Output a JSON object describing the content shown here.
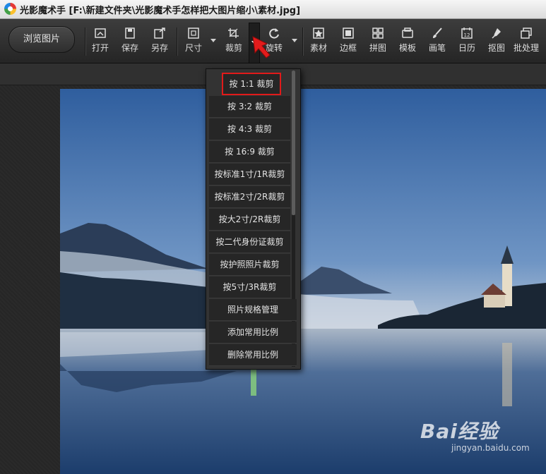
{
  "window": {
    "title": "光影魔术手 [F:\\新建文件夹\\光影魔术手怎样把大图片缩小\\素材.jpg]"
  },
  "toolbar": {
    "browse_label": "浏览图片",
    "tools": [
      {
        "label": "打开",
        "icon": "open-icon"
      },
      {
        "label": "保存",
        "icon": "save-icon"
      },
      {
        "label": "另存",
        "icon": "save-as-icon"
      },
      {
        "label": "尺寸",
        "icon": "resize-icon"
      },
      {
        "label": "裁剪",
        "icon": "crop-icon"
      },
      {
        "label": "旋转",
        "icon": "rotate-icon"
      },
      {
        "label": "素材",
        "icon": "material-icon"
      },
      {
        "label": "边框",
        "icon": "frame-icon"
      },
      {
        "label": "拼图",
        "icon": "collage-icon"
      },
      {
        "label": "模板",
        "icon": "template-icon"
      },
      {
        "label": "画笔",
        "icon": "brush-icon"
      },
      {
        "label": "日历",
        "icon": "calendar-icon"
      },
      {
        "label": "抠图",
        "icon": "cutout-icon"
      },
      {
        "label": "批处理",
        "icon": "batch-icon"
      }
    ]
  },
  "crop_menu": {
    "items": [
      "按 1:1 裁剪",
      "按 3:2 裁剪",
      "按 4:3 裁剪",
      "按 16:9 裁剪",
      "按标准1寸/1R裁剪",
      "按标准2寸/2R裁剪",
      "按大2寸/2R裁剪",
      "按二代身份证裁剪",
      "按护照照片裁剪",
      "按5寸/3R裁剪",
      "照片规格管理",
      "添加常用比例",
      "删除常用比例"
    ],
    "selected_index": 0,
    "highlight_color": "#e11a1a"
  },
  "watermark": {
    "logo": "Bai经验",
    "url": "jingyan.baidu.com"
  }
}
